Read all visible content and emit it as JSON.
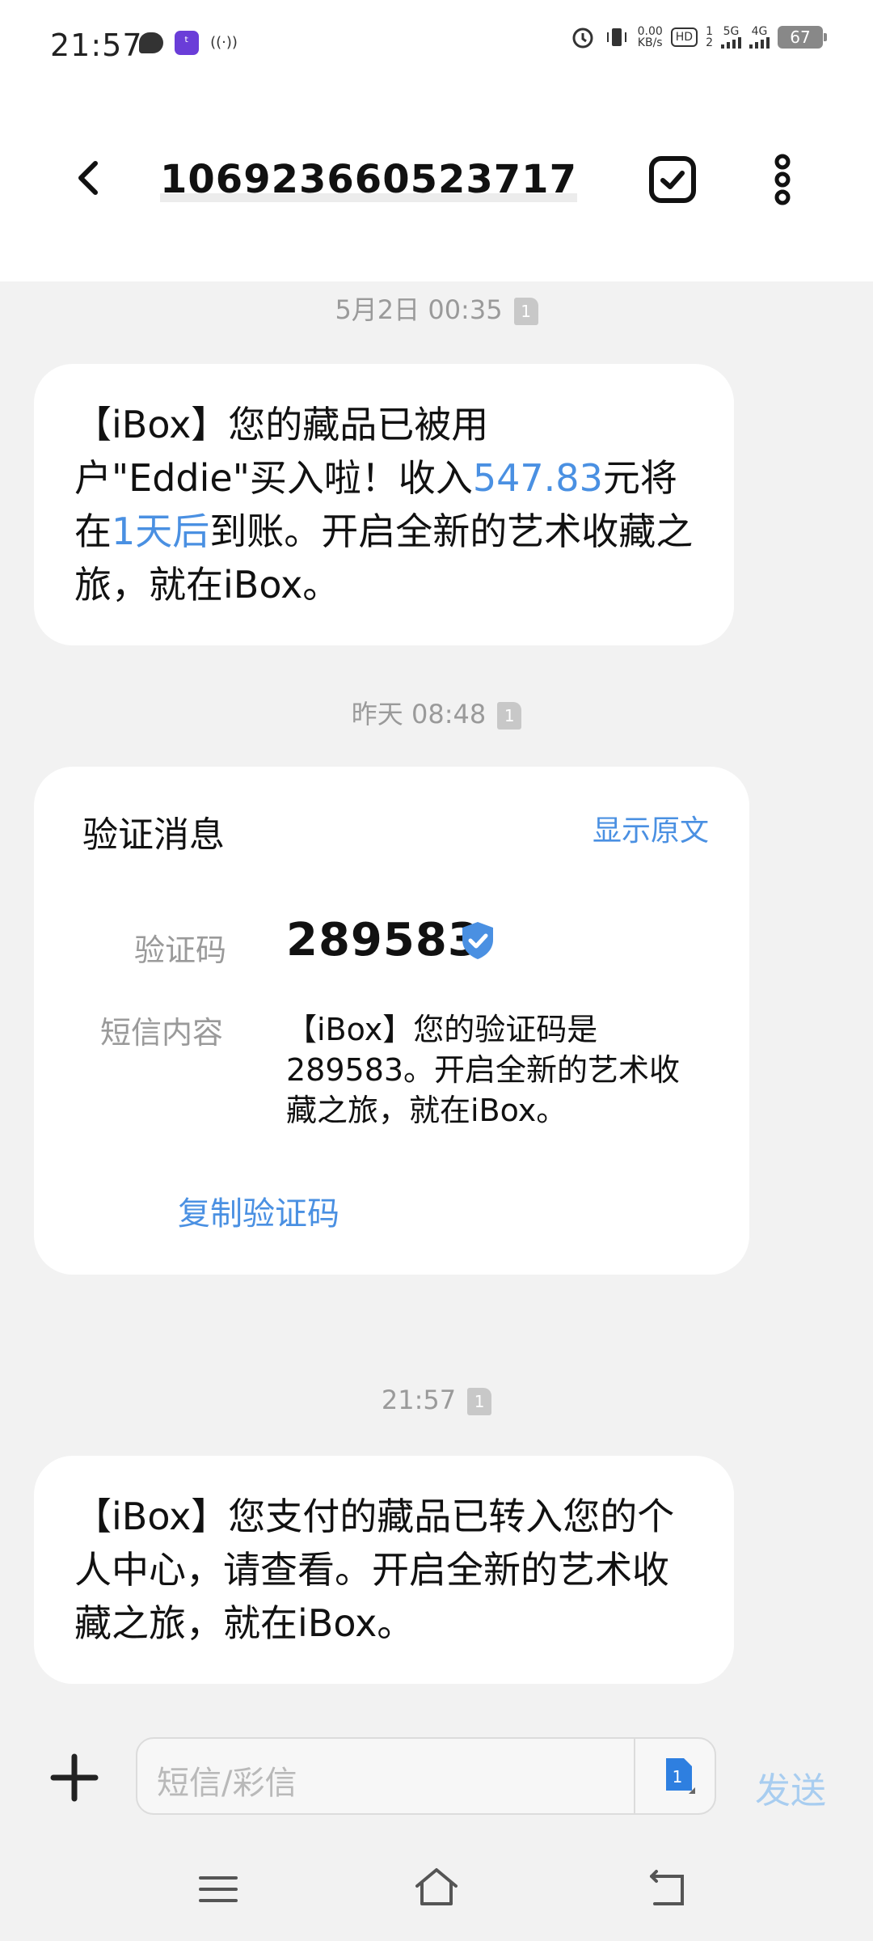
{
  "status_bar": {
    "time": "21:57",
    "app_icon_text": "ᵗ",
    "net_speed_value": "0.00",
    "net_speed_unit": "KB/s",
    "hd_label": "HD",
    "sim1_label": "1",
    "sim2_label": "2",
    "net1": "5G",
    "net2": "4G",
    "battery": "67"
  },
  "header": {
    "contact": "106923660523717",
    "icons": [
      "back-icon",
      "check-square-icon",
      "more-vertical-icon"
    ]
  },
  "messages": [
    {
      "timestamp": "5月2日  00:35",
      "sim": "1",
      "parts": [
        "【iBox】您的藏品已被用户\"Eddie\"买入啦！收入",
        "547.83",
        "元将在",
        "1天后",
        "到账。开启全新的艺术收藏之旅，就在iBox。"
      ]
    },
    {
      "timestamp": "昨天  08:48",
      "sim": "1",
      "card": {
        "title": "验证消息",
        "action": "显示原文",
        "code_label": "验证码",
        "code": "289583",
        "content_label": "短信内容",
        "content": "【iBox】您的验证码是289583。开启全新的艺术收藏之旅，就在iBox。",
        "copy_label": "复制验证码"
      }
    },
    {
      "timestamp": "21:57",
      "sim": "1",
      "text": "【iBox】您支付的藏品已转入您的个人中心，请查看。开启全新的艺术收藏之旅，就在iBox。"
    }
  ],
  "input_bar": {
    "placeholder": "短信/彩信",
    "sim": "1",
    "send_label": "发送"
  },
  "nav_bar": {
    "icons": [
      "menu-icon",
      "home-icon",
      "back-nav-icon"
    ]
  },
  "colors": {
    "accent": "#4a90e2",
    "send_disabled": "#a8cdf0",
    "background": "#f2f2f2"
  }
}
